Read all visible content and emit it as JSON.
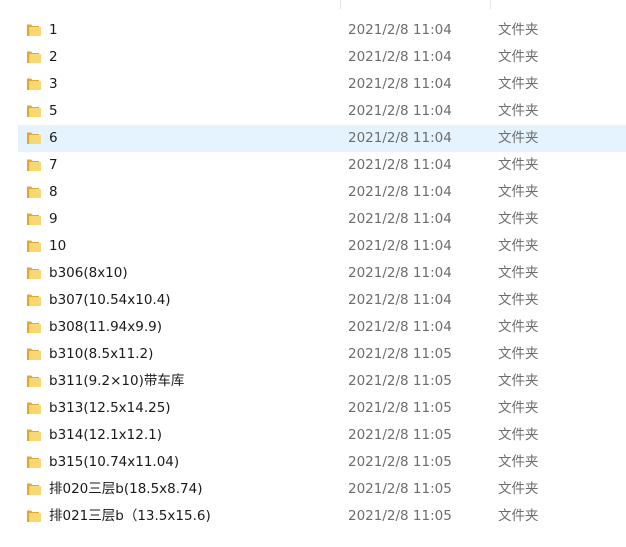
{
  "colors": {
    "hover_row": "#e5f3ff",
    "folder_yellow": "#f8d775",
    "folder_dark": "#e0a82e",
    "secondary_text": "#6d6d6d"
  },
  "hovered_row_index": 4,
  "folder_icon": "folder-icon",
  "rows": [
    {
      "name": "1",
      "modified": "2021/2/8 11:04",
      "type": "文件夹"
    },
    {
      "name": "2",
      "modified": "2021/2/8 11:04",
      "type": "文件夹"
    },
    {
      "name": "3",
      "modified": "2021/2/8 11:04",
      "type": "文件夹"
    },
    {
      "name": "5",
      "modified": "2021/2/8 11:04",
      "type": "文件夹"
    },
    {
      "name": "6",
      "modified": "2021/2/8 11:04",
      "type": "文件夹"
    },
    {
      "name": "7",
      "modified": "2021/2/8 11:04",
      "type": "文件夹"
    },
    {
      "name": "8",
      "modified": "2021/2/8 11:04",
      "type": "文件夹"
    },
    {
      "name": "9",
      "modified": "2021/2/8 11:04",
      "type": "文件夹"
    },
    {
      "name": "10",
      "modified": "2021/2/8 11:04",
      "type": "文件夹"
    },
    {
      "name": "b306(8x10)",
      "modified": "2021/2/8 11:04",
      "type": "文件夹"
    },
    {
      "name": "b307(10.54x10.4)",
      "modified": "2021/2/8 11:04",
      "type": "文件夹"
    },
    {
      "name": "b308(11.94x9.9)",
      "modified": "2021/2/8 11:04",
      "type": "文件夹"
    },
    {
      "name": "b310(8.5x11.2)",
      "modified": "2021/2/8 11:05",
      "type": "文件夹"
    },
    {
      "name": "b311(9.2×10)带车库",
      "modified": "2021/2/8 11:05",
      "type": "文件夹"
    },
    {
      "name": "b313(12.5x14.25)",
      "modified": "2021/2/8 11:05",
      "type": "文件夹"
    },
    {
      "name": "b314(12.1x12.1)",
      "modified": "2021/2/8 11:05",
      "type": "文件夹"
    },
    {
      "name": "b315(10.74x11.04)",
      "modified": "2021/2/8 11:05",
      "type": "文件夹"
    },
    {
      "name": "排020三层b(18.5x8.74)",
      "modified": "2021/2/8 11:05",
      "type": "文件夹"
    },
    {
      "name": "排021三层b（13.5x15.6)",
      "modified": "2021/2/8 11:05",
      "type": "文件夹"
    }
  ]
}
